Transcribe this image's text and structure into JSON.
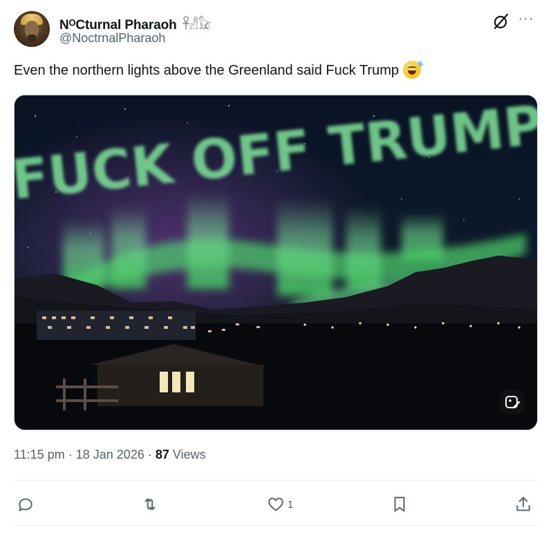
{
  "author": {
    "display_name": "NᴼCturnal Pharaoh",
    "name_glyphs": "𓋹𓀭𓃠",
    "handle": "@NoctrnalPharaoh",
    "avatar_icon": "pharaoh-avatar"
  },
  "tweet": {
    "text": "Even the northern lights above the Greenland said Fuck Trump",
    "emoji": "grinning-face-with-sweat",
    "time": "11:15 pm",
    "date": "18 Jan 2026",
    "views_count": "87",
    "views_label": "Views",
    "separator": "·"
  },
  "media": {
    "sky_text": "FUCK OFF TRUMP",
    "badge_icon": "edit-image-icon"
  },
  "actions": {
    "reply": {
      "icon": "reply-icon",
      "count": ""
    },
    "repost": {
      "icon": "repost-icon",
      "count": ""
    },
    "like": {
      "icon": "heart-icon",
      "count": "1"
    },
    "bookmark": {
      "icon": "bookmark-icon",
      "count": ""
    },
    "share": {
      "icon": "share-icon",
      "count": ""
    }
  },
  "colors": {
    "text": "#0f1419",
    "secondary": "#536471",
    "aurora": "#6fdc8c"
  }
}
